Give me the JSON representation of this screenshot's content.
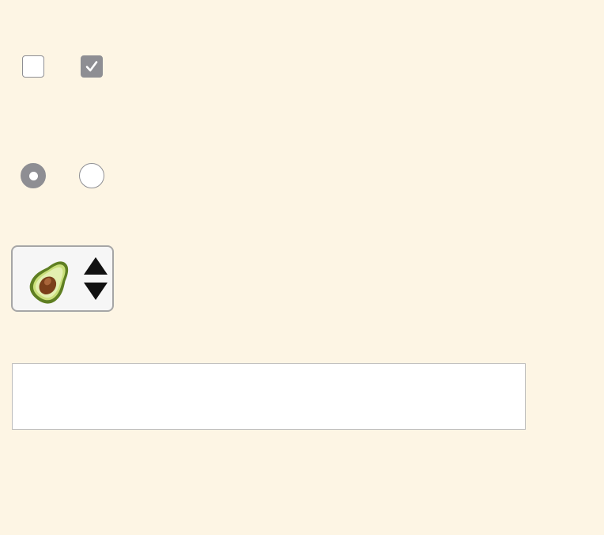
{
  "checkboxes": [
    {
      "name": "checkbox-unchecked",
      "checked": false
    },
    {
      "name": "checkbox-checked",
      "checked": true
    }
  ],
  "radios": [
    {
      "name": "radio-selected",
      "checked": true
    },
    {
      "name": "radio-unselected",
      "checked": false
    }
  ],
  "select": {
    "selected_icon": "avocado-icon"
  },
  "textfield": {
    "value": "",
    "placeholder": ""
  },
  "colors": {
    "background": "#fdf5e4",
    "control_gray": "#8e8e93",
    "avocado_skin": "#6b8f2a",
    "avocado_flesh": "#d6e79a",
    "avocado_pit": "#8a4b22"
  }
}
